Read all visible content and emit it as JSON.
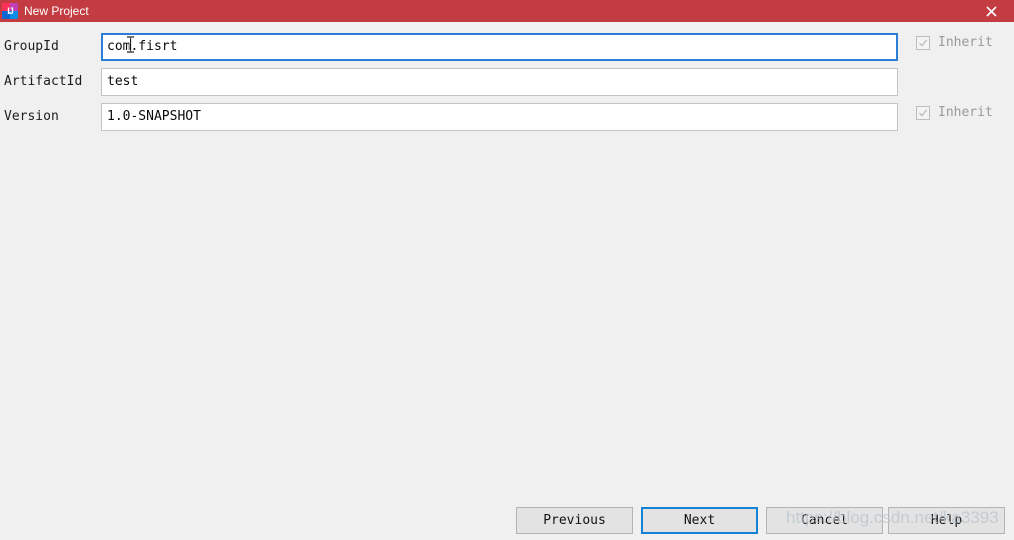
{
  "window": {
    "title": "New Project",
    "icon": "intellij-idea-icon",
    "titlebar_color": "#c33c41",
    "background_color": "#f0f0f0",
    "close_label": "×"
  },
  "form": {
    "fields": [
      {
        "label": "GroupId",
        "value": "com.fisrt",
        "placeholder": "",
        "focused": true,
        "inherit": {
          "label": "Inherit",
          "checked": true,
          "enabled": false
        }
      },
      {
        "label": "ArtifactId",
        "value": "test",
        "placeholder": "",
        "focused": false,
        "inherit": null
      },
      {
        "label": "Version",
        "value": "1.0-SNAPSHOT",
        "placeholder": "",
        "focused": false,
        "inherit": {
          "label": "Inherit",
          "checked": true,
          "enabled": false
        }
      }
    ]
  },
  "buttons": {
    "previous": "Previous",
    "next": "Next",
    "cancel": "Cancel",
    "help": "Help",
    "default_focus": "Next",
    "focus_color": "#1383d6"
  },
  "watermark": {
    "text": "https://blog.csdn.net/ka3393"
  }
}
